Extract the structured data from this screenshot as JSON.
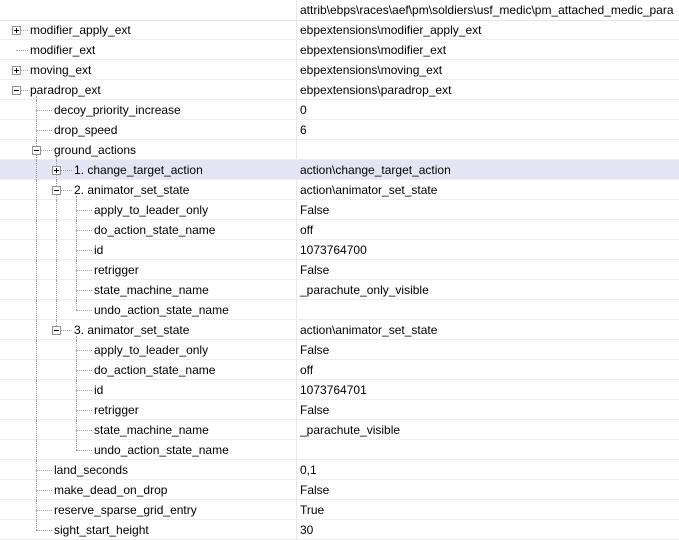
{
  "header": {
    "path": "attrib\\ebps\\races\\aef\\pm\\soldiers\\usf_medic\\pm_attached_medic_para"
  },
  "rows": [
    {
      "label": "modifier_apply_ext",
      "value": "ebpextensions\\modifier_apply_ext",
      "depth": 0,
      "expander": "plus"
    },
    {
      "label": "modifier_ext",
      "value": "ebpextensions\\modifier_ext",
      "depth": 0,
      "expander": null
    },
    {
      "label": "moving_ext",
      "value": "ebpextensions\\moving_ext",
      "depth": 0,
      "expander": "plus"
    },
    {
      "label": "paradrop_ext",
      "value": "ebpextensions\\paradrop_ext",
      "depth": 0,
      "expander": "minus"
    },
    {
      "label": "decoy_priority_increase",
      "value": "0",
      "depth": 1,
      "expander": null
    },
    {
      "label": "drop_speed",
      "value": "6",
      "depth": 1,
      "expander": null
    },
    {
      "label": "ground_actions",
      "value": "",
      "depth": 1,
      "expander": "minus"
    },
    {
      "label": "1. change_target_action",
      "value": "action\\change_target_action",
      "depth": 2,
      "expander": "plus",
      "selected": true
    },
    {
      "label": "2. animator_set_state",
      "value": "action\\animator_set_state",
      "depth": 2,
      "expander": "minus"
    },
    {
      "label": "apply_to_leader_only",
      "value": "False",
      "depth": 3,
      "expander": null
    },
    {
      "label": "do_action_state_name",
      "value": "off",
      "depth": 3,
      "expander": null
    },
    {
      "label": "id",
      "value": "1073764700",
      "depth": 3,
      "expander": null
    },
    {
      "label": "retrigger",
      "value": "False",
      "depth": 3,
      "expander": null
    },
    {
      "label": "state_machine_name",
      "value": "_parachute_only_visible",
      "depth": 3,
      "expander": null
    },
    {
      "label": "undo_action_state_name",
      "value": "",
      "depth": 3,
      "expander": null
    },
    {
      "label": "3. animator_set_state",
      "value": "action\\animator_set_state",
      "depth": 2,
      "expander": "minus"
    },
    {
      "label": "apply_to_leader_only",
      "value": "False",
      "depth": 3,
      "expander": null
    },
    {
      "label": "do_action_state_name",
      "value": "off",
      "depth": 3,
      "expander": null
    },
    {
      "label": "id",
      "value": "1073764701",
      "depth": 3,
      "expander": null
    },
    {
      "label": "retrigger",
      "value": "False",
      "depth": 3,
      "expander": null
    },
    {
      "label": "state_machine_name",
      "value": "_parachute_visible",
      "depth": 3,
      "expander": null
    },
    {
      "label": "undo_action_state_name",
      "value": "",
      "depth": 3,
      "expander": null
    },
    {
      "label": "land_seconds",
      "value": "0,1",
      "depth": 1,
      "expander": null
    },
    {
      "label": "make_dead_on_drop",
      "value": "False",
      "depth": 1,
      "expander": null
    },
    {
      "label": "reserve_sparse_grid_entry",
      "value": "True",
      "depth": 1,
      "expander": null
    },
    {
      "label": "sight_start_height",
      "value": "30",
      "depth": 1,
      "expander": null
    }
  ]
}
